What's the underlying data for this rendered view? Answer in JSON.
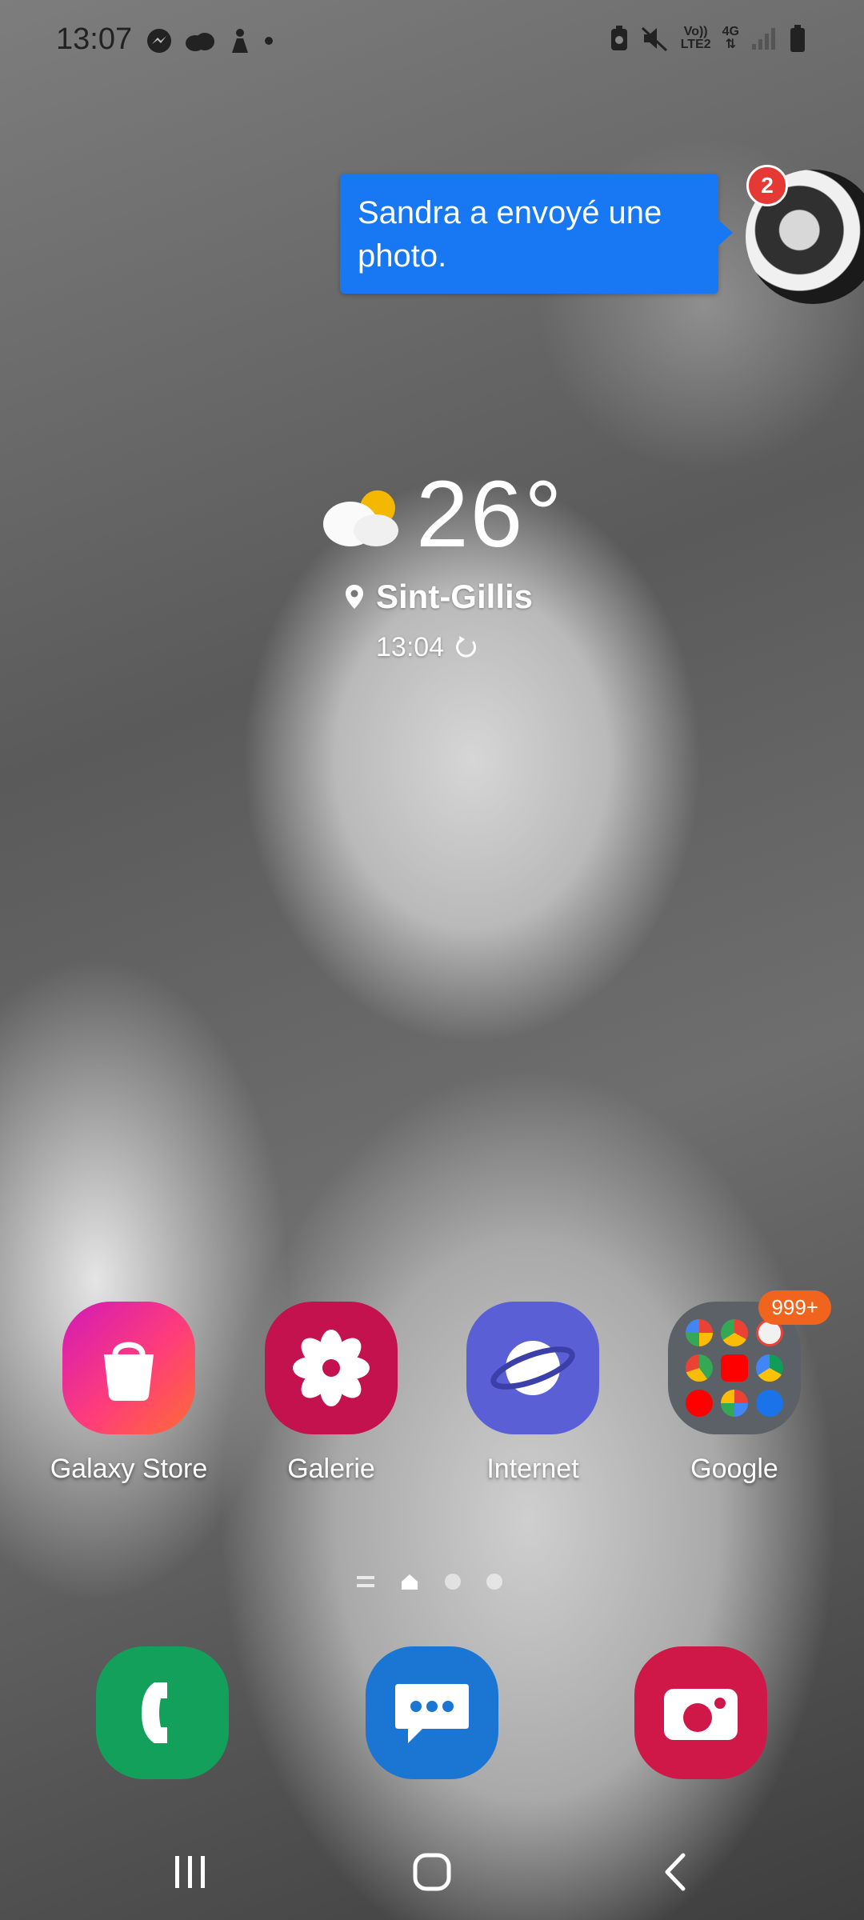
{
  "status_bar": {
    "time": "13:07",
    "left_icons": [
      "messenger-icon",
      "cloud-icon",
      "figure-icon",
      "dot-icon"
    ],
    "volte_top": "Vo))",
    "volte_bottom": "LTE2",
    "network": "4G",
    "right_icons": [
      "battery-saver-icon",
      "mute-icon",
      "signal-icon",
      "battery-icon"
    ]
  },
  "chat_head": {
    "message": "Sandra a envoyé une photo.",
    "badge": "2"
  },
  "weather": {
    "temperature": "26°",
    "location": "Sint-Gillis",
    "updated": "13:04"
  },
  "apps": [
    {
      "label": "Galaxy Store",
      "icon": "shopping-bag-icon"
    },
    {
      "label": "Galerie",
      "icon": "flower-icon"
    },
    {
      "label": "Internet",
      "icon": "planet-icon"
    },
    {
      "label": "Google",
      "icon": "folder-icon",
      "badge": "999+"
    }
  ],
  "dock": [
    {
      "icon": "phone-icon"
    },
    {
      "icon": "messages-icon"
    },
    {
      "icon": "camera-icon"
    }
  ],
  "colors": {
    "messenger_blue": "#1877f2",
    "badge_red": "#e53935",
    "badge_orange": "#f0641e"
  }
}
